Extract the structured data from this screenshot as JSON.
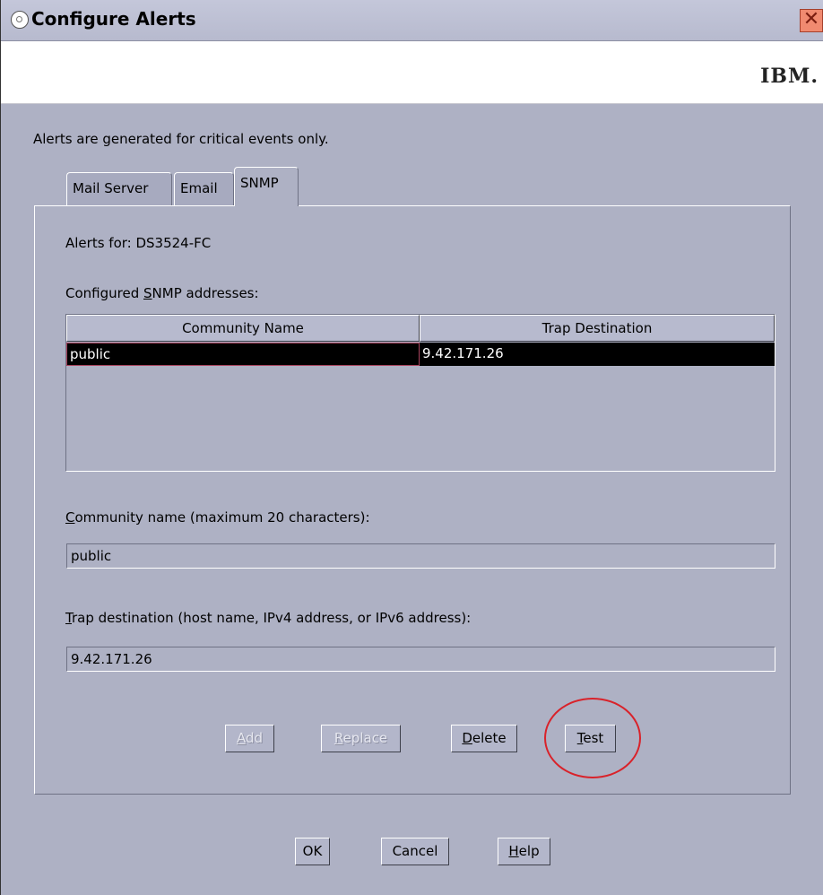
{
  "window": {
    "title": "Configure Alerts",
    "close_glyph": "✕"
  },
  "brand": {
    "logo_text": "IBM."
  },
  "info_text": "Alerts are generated for critical events only.",
  "tabs": [
    {
      "label": "Mail Server",
      "active": false
    },
    {
      "label": "Email",
      "active": false
    },
    {
      "label": "SNMP",
      "active": true
    }
  ],
  "snmp": {
    "alerts_for_label": "Alerts for: DS3524-FC",
    "configured_label_pre": "Configured ",
    "configured_label_ul": "S",
    "configured_label_post": "NMP addresses:",
    "table": {
      "columns": [
        "Community Name",
        "Trap Destination"
      ],
      "rows": [
        {
          "community": "public",
          "destination": "9.42.171.26"
        }
      ]
    },
    "community_label_ul": "C",
    "community_label_post": "ommunity name (maximum 20 characters):",
    "community_value": "public",
    "trap_label_ul": "T",
    "trap_label_post": "rap destination (host name, IPv4 address, or IPv6 address):",
    "trap_value": "9.42.171.26",
    "buttons": {
      "add_ul": "A",
      "add_rest": "dd",
      "replace_ul": "R",
      "replace_rest": "eplace",
      "delete_ul": "D",
      "delete_rest": "elete",
      "test_ul": "T",
      "test_rest": "est"
    }
  },
  "footer": {
    "ok": "OK",
    "cancel": "Cancel",
    "help_ul": "H",
    "help_rest": "elp"
  },
  "colors": {
    "highlight": "#d9222a",
    "selection": "#000000",
    "background": "#aeb1c4"
  }
}
